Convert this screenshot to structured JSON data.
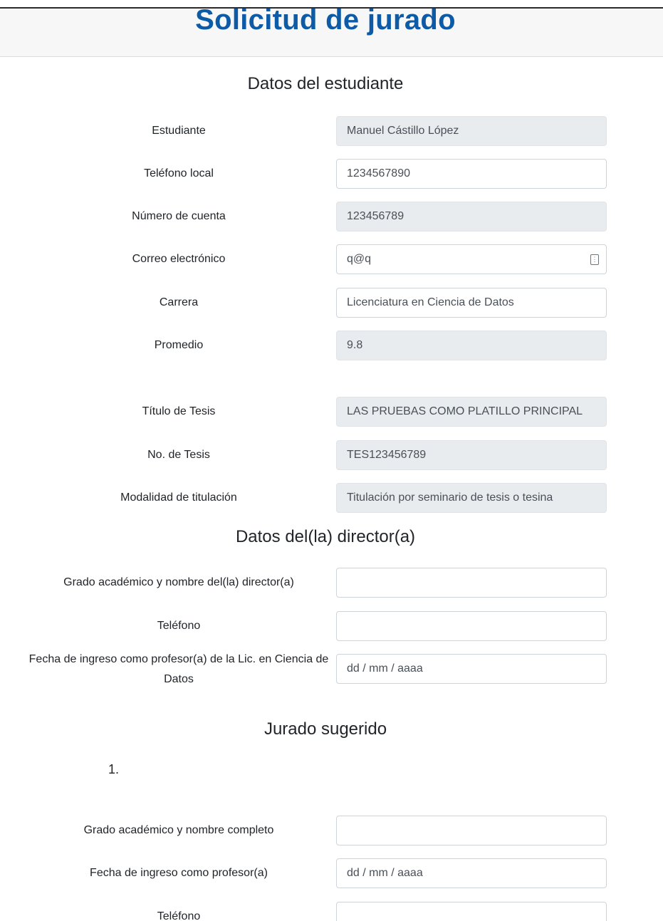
{
  "page": {
    "title": "Solicitud de jurado"
  },
  "student_section": {
    "heading": "Datos del estudiante",
    "fields": [
      {
        "label": "Estudiante",
        "value": "Manuel Cástillo López",
        "readonly": true
      },
      {
        "label": "Teléfono local",
        "value": "1234567890",
        "readonly": false
      },
      {
        "label": "Número de cuenta",
        "value": "123456789",
        "readonly": true
      },
      {
        "label": "Correo electrónico",
        "value": "q@q",
        "readonly": false
      },
      {
        "label": "Carrera",
        "value": "Licenciatura en Ciencia de Datos",
        "readonly": false
      },
      {
        "label": "Promedio",
        "value": "9.8",
        "readonly": true
      },
      {
        "label": "Título de Tesis",
        "value": "LAS PRUEBAS COMO PLATILLO PRINCIPAL",
        "readonly": true
      },
      {
        "label": "No. de Tesis",
        "value": "TES123456789",
        "readonly": true
      },
      {
        "label": "Modalidad de titulación",
        "value": "Titulación por seminario de tesis o tesina",
        "readonly": true
      }
    ]
  },
  "director_section": {
    "heading": "Datos del(la) director(a)",
    "fields": [
      {
        "label": "Grado académico y nombre del(la) director(a)",
        "value": ""
      },
      {
        "label": "Teléfono",
        "value": ""
      },
      {
        "label": "Fecha de ingreso como profesor(a) de la Lic. en Ciencia de Datos",
        "placeholder": "dd / mm / aaaa"
      }
    ]
  },
  "jury_section": {
    "heading": "Jurado sugerido",
    "item_number": "1.",
    "fields": [
      {
        "label": "Grado académico y nombre completo",
        "value": ""
      },
      {
        "label": "Fecha de ingreso como profesor(a)",
        "placeholder": "dd / mm / aaaa"
      },
      {
        "label": "Teléfono",
        "value": ""
      }
    ]
  },
  "icons": {
    "email_field_icon": "contact-card-icon"
  }
}
